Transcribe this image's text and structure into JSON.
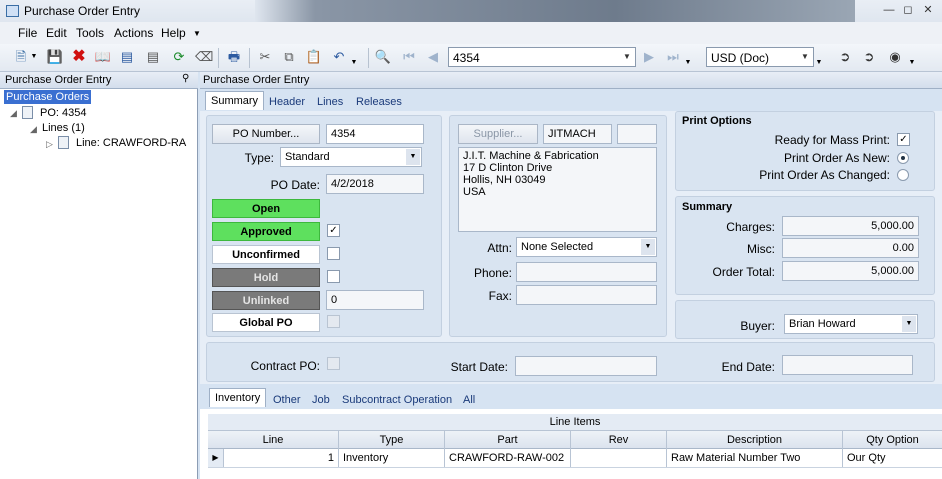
{
  "window": {
    "title": "Purchase Order Entry"
  },
  "menu": [
    "File",
    "Edit",
    "Tools",
    "Actions",
    "Help"
  ],
  "toolbar": {
    "po_combo": "4354",
    "currency_combo": "USD (Doc)"
  },
  "left_pane": {
    "header": "Purchase Order Entry",
    "tree": {
      "root": "Purchase Orders",
      "po": "PO: 4354",
      "lines": "Lines (1)",
      "line": "Line: CRAWFORD-RA"
    }
  },
  "right_pane": {
    "header": "Purchase Order Entry"
  },
  "tabs": [
    "Summary",
    "Header",
    "Lines",
    "Releases"
  ],
  "po": {
    "po_number_button": "PO Number...",
    "po_number": "4354",
    "type_label": "Type:",
    "type_value": "Standard",
    "po_date_label": "PO Date:",
    "po_date": "4/2/2018",
    "status_open": "Open",
    "status_approved": "Approved",
    "status_unconfirmed": "Unconfirmed",
    "status_hold": "Hold",
    "status_unlinked": "Unlinked",
    "unlinked_value": "0",
    "status_global": "Global PO",
    "approved_checked": true
  },
  "supplier": {
    "button": "Supplier...",
    "id": "JITMACH",
    "address": [
      "J.I.T. Machine & Fabrication",
      "17 D Clinton Drive",
      "Hollis, NH  03049",
      "USA"
    ],
    "attn_label": "Attn:",
    "attn_value": "None Selected",
    "phone_label": "Phone:",
    "fax_label": "Fax:"
  },
  "print_options": {
    "title": "Print Options",
    "ready_label": "Ready for Mass Print:",
    "as_new_label": "Print Order As New:",
    "as_changed_label": "Print Order As Changed:"
  },
  "summary": {
    "title": "Summary",
    "charges_label": "Charges:",
    "charges": "5,000.00",
    "misc_label": "Misc:",
    "misc": "0.00",
    "total_label": "Order Total:",
    "total": "5,000.00"
  },
  "buyer": {
    "label": "Buyer:",
    "value": "Brian Howard"
  },
  "contract": {
    "contract_label": "Contract PO:",
    "start_label": "Start Date:",
    "end_label": "End Date:"
  },
  "bottom_tabs": [
    "Inventory",
    "Other",
    "Job",
    "Subcontract Operation",
    "All"
  ],
  "grid": {
    "title": "Line Items",
    "columns": [
      "Line",
      "Type",
      "Part",
      "Rev",
      "Description",
      "Qty Option"
    ],
    "rows": [
      [
        "1",
        "Inventory",
        "CRAWFORD-RAW-002",
        "",
        "Raw Material Number Two",
        "Our Qty"
      ]
    ]
  },
  "colors": {
    "green_status": "#5ee05e",
    "gray_status": "#7a7a7a",
    "panel_bg": "#d9e4f1"
  }
}
